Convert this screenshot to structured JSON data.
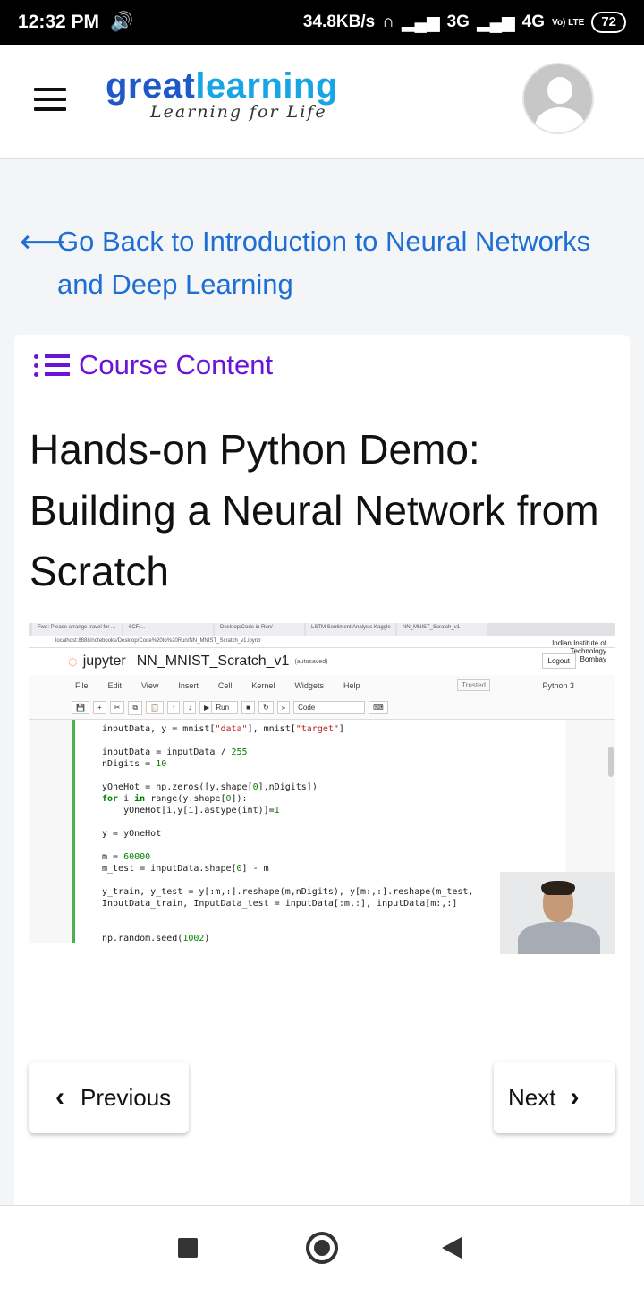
{
  "status_bar": {
    "time": "12:32 PM",
    "speed": "34.8KB/s",
    "network": "3G",
    "network2": "4G",
    "lte": "Vo) LTE",
    "battery": "72"
  },
  "header": {
    "logo_word1": "great",
    "logo_word2": "learning",
    "tagline": "Learning for Life"
  },
  "back_link": {
    "text": "Go Back to Introduction to Neural Networks and Deep Learning"
  },
  "course_content": {
    "label": "Course Content"
  },
  "lesson": {
    "title": "Hands-on Python Demo: Building a Neural Network from Scratch"
  },
  "video": {
    "tabs": [
      "Fwd: Please arrange travel for ...",
      "6CFr...",
      "Desktop/Code in Run/",
      "LSTM Sentiment Analysis Kaggle",
      "NN_MNIST_Scratch_v1"
    ],
    "url": "localhost:8888/notebooks/Desktop/Code%20to%20Run/NN_MNIST_Scratch_v1.ipynb",
    "jupyter_label": "jupyter",
    "notebook_name": "NN_MNIST_Scratch_v1",
    "autosaved": "(autosaved)",
    "institute": "Indian Institute of Technology Bombay",
    "logout": "Logout",
    "menu": [
      "File",
      "Edit",
      "View",
      "Insert",
      "Cell",
      "Kernel",
      "Widgets",
      "Help"
    ],
    "trusted": "Trusted",
    "kernel": "Python 3",
    "run_label": "Run",
    "cell_type": "Code"
  },
  "buttons": {
    "previous": "Previous",
    "next": "Next"
  }
}
